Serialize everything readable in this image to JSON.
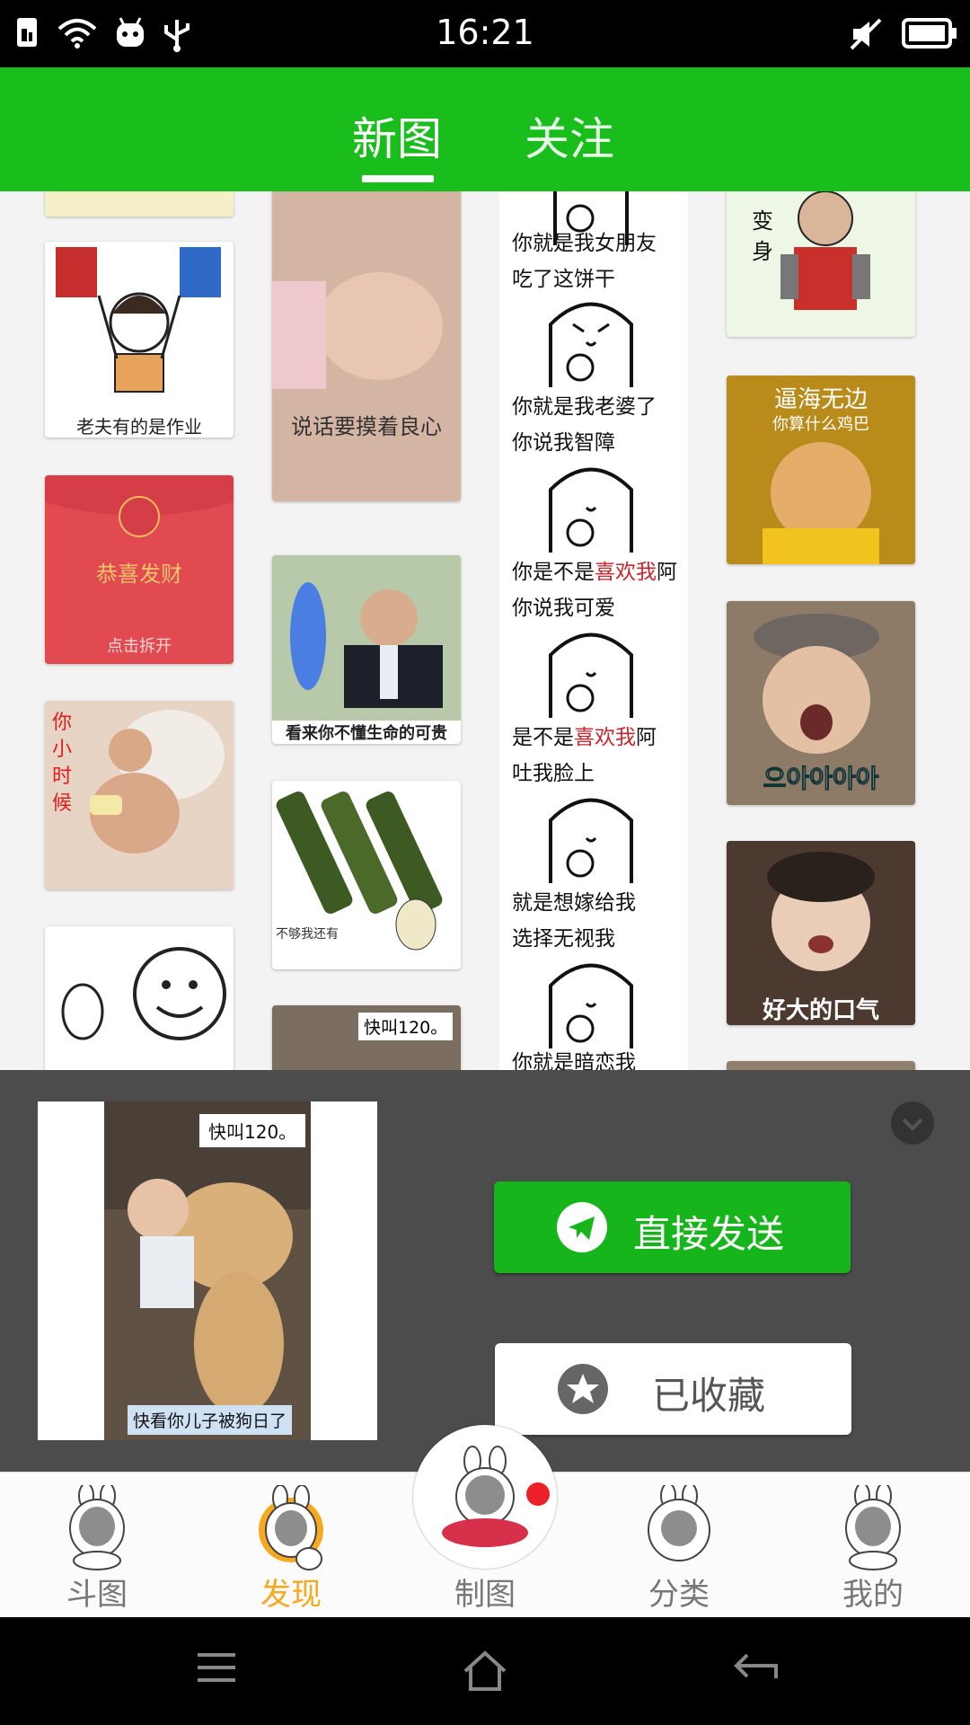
{
  "status_bar": {
    "time": "16:21",
    "icons_left": [
      "sim-icon",
      "wifi-icon",
      "android-icon",
      "usb-icon"
    ],
    "icons_right": [
      "mute-icon",
      "battery-icon"
    ]
  },
  "header": {
    "tabs": [
      {
        "label": "新图",
        "active": true
      },
      {
        "label": "关注",
        "active": false
      }
    ],
    "accent": "#19bd1c"
  },
  "feed": {
    "col1": [
      {
        "caption": "老夫有的是作业"
      },
      {
        "title": "恭喜发财",
        "subtitle": "点击拆开"
      },
      {
        "caption": "你小时候"
      },
      {
        "caption": ""
      }
    ],
    "col2": [
      {
        "caption": "说话要摸着良心"
      },
      {
        "caption": "看来你不懂生命的可贵"
      },
      {
        "caption": "不够我还有"
      },
      {
        "caption": "快叫120。"
      }
    ],
    "comic_lines": [
      {
        "text": "你就是我女朋友"
      },
      {
        "text": "吃了这饼干"
      },
      {
        "text": "你就是我老婆了"
      },
      {
        "text": "你说我智障"
      },
      {
        "pre": "你是不是",
        "hl": "喜欢我",
        "post": "阿"
      },
      {
        "text": "你说我可爱"
      },
      {
        "pre": "是不是",
        "hl": "喜欢我",
        "post": "阿"
      },
      {
        "text": "吐我脸上"
      },
      {
        "text": "就是想嫁给我"
      },
      {
        "text": "选择无视我"
      },
      {
        "text": "你就是暗恋我"
      }
    ],
    "col4": [
      {
        "caption": "变身"
      },
      {
        "title": "逼海无边",
        "subtitle": "你算什么鸡巴"
      },
      {
        "caption": "으아아아아"
      },
      {
        "caption": "好大的口气"
      }
    ]
  },
  "sheet": {
    "preview_top_caption": "快叫120。",
    "preview_bottom_caption": "快看你儿子被狗日了",
    "send_label": "直接发送",
    "favorite_label": "已收藏"
  },
  "bottom_nav": {
    "items": [
      {
        "label": "斗图",
        "active": false
      },
      {
        "label": "发现",
        "active": true
      },
      {
        "label": "制图",
        "active": false
      },
      {
        "label": "分类",
        "active": false
      },
      {
        "label": "我的",
        "active": false
      }
    ],
    "active_color": "#f7a91d"
  },
  "system_nav": [
    "menu-icon",
    "home-icon",
    "back-icon"
  ]
}
